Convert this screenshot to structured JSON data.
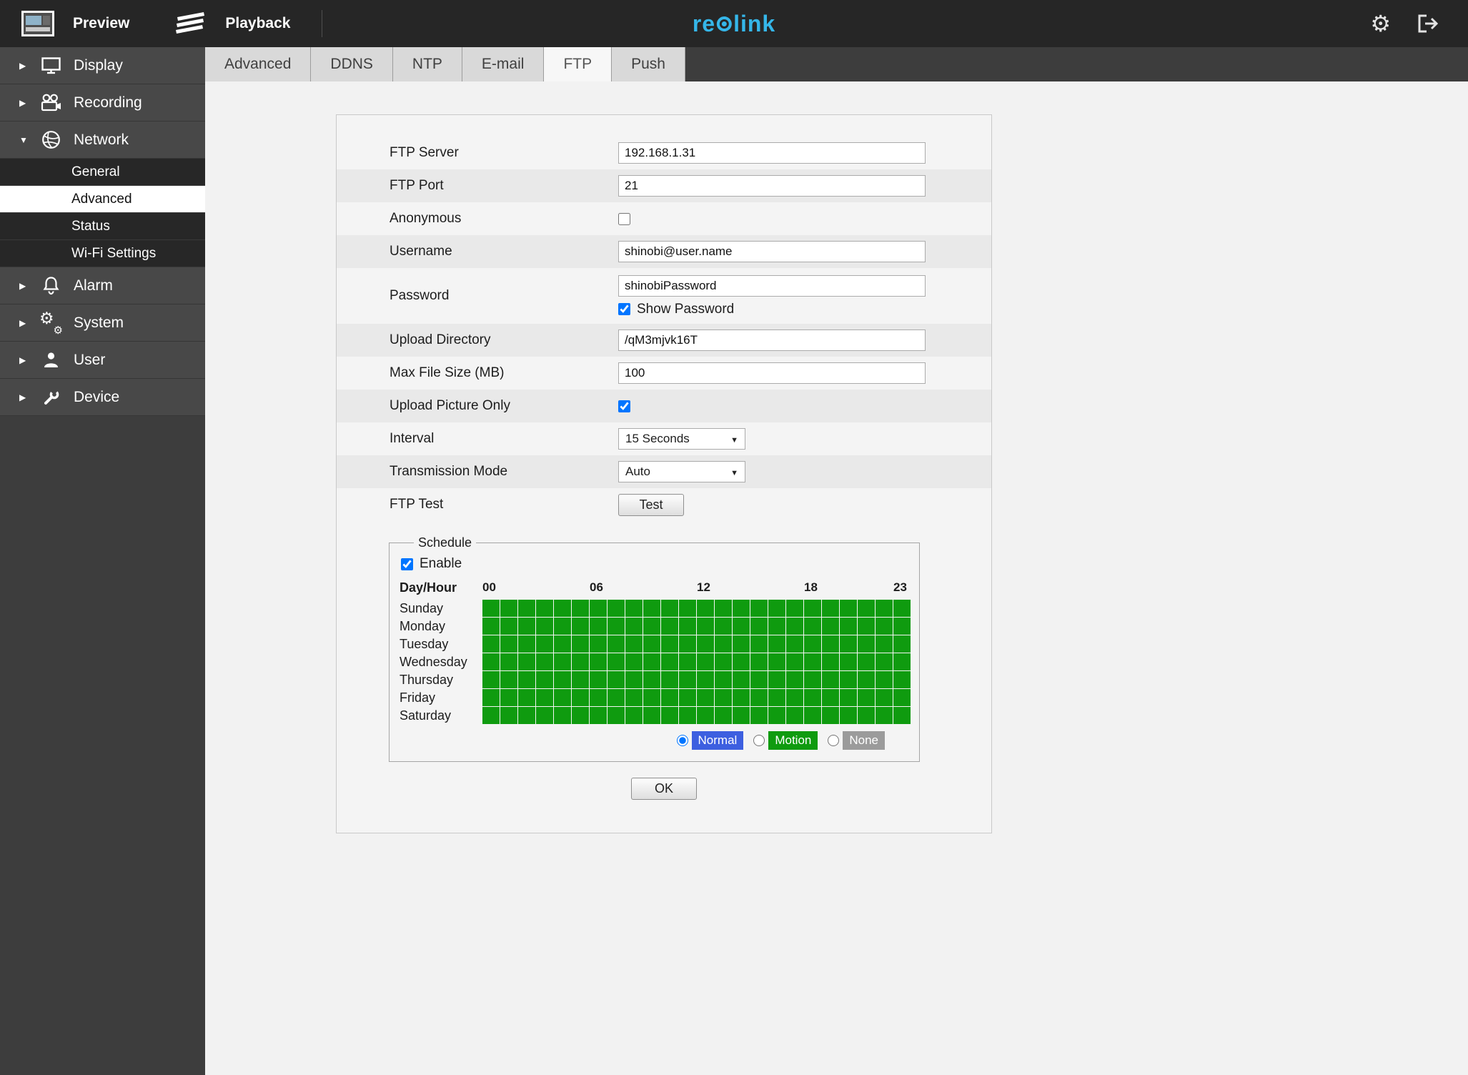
{
  "topbar": {
    "preview_label": "Preview",
    "playback_label": "Playback",
    "logo_text": "reolink",
    "logo": {
      "left": "re",
      "right": "link"
    },
    "logo_color": "#35b6e9"
  },
  "sidebar": {
    "items": [
      {
        "id": "display",
        "label": "Display",
        "icon": "monitor-icon",
        "expanded": false
      },
      {
        "id": "recording",
        "label": "Recording",
        "icon": "video-camera-icon",
        "expanded": false
      },
      {
        "id": "network",
        "label": "Network",
        "icon": "globe-icon",
        "expanded": true,
        "children": [
          {
            "label": "General",
            "selected": false
          },
          {
            "label": "Advanced",
            "selected": true
          },
          {
            "label": "Status",
            "selected": false
          },
          {
            "label": "Wi-Fi Settings",
            "selected": false
          }
        ]
      },
      {
        "id": "alarm",
        "label": "Alarm",
        "icon": "bell-icon",
        "expanded": false
      },
      {
        "id": "system",
        "label": "System",
        "icon": "gears-icon",
        "expanded": false
      },
      {
        "id": "user",
        "label": "User",
        "icon": "person-icon",
        "expanded": false
      },
      {
        "id": "device",
        "label": "Device",
        "icon": "wrench-icon",
        "expanded": false
      }
    ]
  },
  "tabs": {
    "items": [
      "Advanced",
      "DDNS",
      "NTP",
      "E-mail",
      "FTP",
      "Push"
    ],
    "active": "FTP"
  },
  "form": {
    "rows": [
      {
        "id": "ftp-server",
        "label": "FTP Server",
        "control": "text",
        "value": "192.168.1.31"
      },
      {
        "id": "ftp-port",
        "label": "FTP Port",
        "control": "text",
        "value": "21"
      },
      {
        "id": "anonymous",
        "label": "Anonymous",
        "control": "checkbox",
        "checked": false
      },
      {
        "id": "username",
        "label": "Username",
        "control": "text",
        "value": "shinobi@user.name"
      },
      {
        "id": "password",
        "label": "Password",
        "control": "password",
        "value": "shinobiPassword",
        "show_password_label": "Show Password",
        "show_password_checked": true
      },
      {
        "id": "upload-directory",
        "label": "Upload Directory",
        "control": "text",
        "value": "/qM3mjvk16T"
      },
      {
        "id": "max-file-size",
        "label": "Max File Size (MB)",
        "control": "text",
        "value": "100"
      },
      {
        "id": "upload-picture-only",
        "label": "Upload Picture Only",
        "control": "checkbox",
        "checked": true
      },
      {
        "id": "interval",
        "label": "Interval",
        "control": "select",
        "value": "15 Seconds"
      },
      {
        "id": "transmission-mode",
        "label": "Transmission Mode",
        "control": "select",
        "value": "Auto"
      },
      {
        "id": "ftp-test",
        "label": "FTP Test",
        "control": "button",
        "value": "Test"
      }
    ]
  },
  "schedule": {
    "legend": "Schedule",
    "enable_label": "Enable",
    "enable_checked": true,
    "day_hour_label": "Day/Hour",
    "hour_labels": [
      {
        "text": "00",
        "col": 0
      },
      {
        "text": "06",
        "col": 6
      },
      {
        "text": "12",
        "col": 12
      },
      {
        "text": "18",
        "col": 18
      },
      {
        "text": "23",
        "col": 23
      }
    ],
    "days": [
      "Sunday",
      "Monday",
      "Tuesday",
      "Wednesday",
      "Thursday",
      "Friday",
      "Saturday"
    ],
    "hours": 24,
    "all_cells_state": "selected",
    "cell_color": "#0f9b0f",
    "modes": [
      {
        "label": "Normal",
        "color": "#3d5fe0",
        "selected": true
      },
      {
        "label": "Motion",
        "color": "#0f9b0f",
        "selected": false
      },
      {
        "label": "None",
        "color": "#9b9b9b",
        "selected": false
      }
    ]
  },
  "ok_label": "OK"
}
